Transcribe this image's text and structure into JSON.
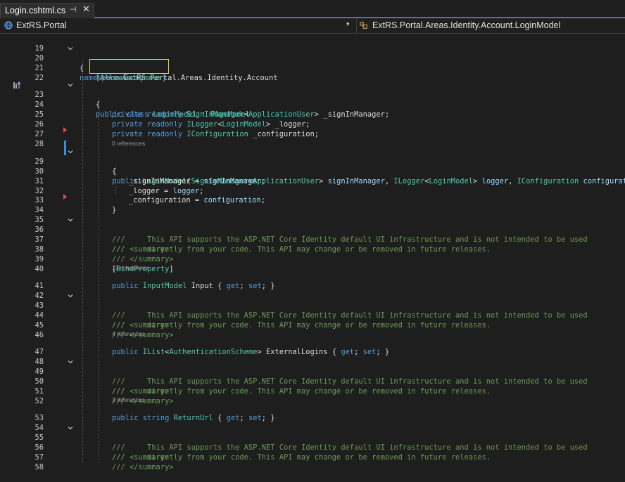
{
  "tab": {
    "title": "Login.cshtml.cs",
    "pin_glyph": "⊣",
    "close_glyph": "✕"
  },
  "nav": {
    "project": "ExtRS.Portal",
    "member": "ExtRS.Portal.Areas.Identity.Account.LoginModel",
    "caret": "▾"
  },
  "colors": {
    "accent": "#6c5fc7",
    "highlight_box": "#e2d84a",
    "breakpoint": "#d9534f",
    "change_bar": "#3b8ee8"
  },
  "lenses": {
    "l23": "7 references",
    "l29": "0 references",
    "l41": "13 references",
    "l47": "4 references",
    "l53": "3 references"
  },
  "code": {
    "l19": "",
    "l20_kw": "namespace",
    "l20_ns": " ExtRS.Portal.Areas.Identity.Account",
    "l21": "{",
    "l22_attr": "[AllowAnonymous]",
    "l23_kw": "public class ",
    "l23_name": "LoginModel",
    "l23_sep": " : ",
    "l23_base": "PageModel",
    "l24": "{",
    "l25_kw": "private readonly ",
    "l25_t1": "SignInManager",
    "l25_lt": "<",
    "l25_t2": "ApplicationUser",
    "l25_rest": "> _signInManager;",
    "l26_kw": "private readonly ",
    "l26_t1": "ILogger",
    "l26_lt": "<",
    "l26_t2": "LoginModel",
    "l26_rest": "> _logger;",
    "l27_kw": "private readonly ",
    "l27_t1": "IConfiguration",
    "l27_rest": " _configuration;",
    "l28": "",
    "l29_kw": "public ",
    "l29_name": "LoginModel",
    "l29_p1": "(",
    "l29_t1": "SignInManager",
    "l29_lt": "<",
    "l29_t2": "ApplicationUser",
    "l29_g": "> ",
    "l29_a1": "signInManager",
    "l29_c1": ", ",
    "l29_t3": "ILogger",
    "l29_lt2": "<",
    "l29_t4": "LoginModel",
    "l29_g2": "> ",
    "l29_a2": "logger",
    "l29_c2": ", ",
    "l29_t5": "IConfiguration",
    "l29_sp": " ",
    "l29_a3": "configuration",
    "l29_end": ")",
    "l30": "{",
    "l31_a": "_signInManager = ",
    "l31_b": "signInManager",
    "l31_c": ";",
    "l32_a": "_logger = ",
    "l32_b": "logger",
    "l32_c": ";",
    "l33_a": "_configuration = ",
    "l33_b": "configuration",
    "l33_c": ";",
    "l34": "}",
    "l35": "",
    "sum_open": "/// <summary>",
    "sum_l1": "///     This API supports the ASP.NET Core Identity default UI infrastructure and is not intended to be used",
    "sum_l2": "///     directly from your code. This API may change or be removed in future releases.",
    "sum_close": "/// </summary>",
    "l40_p": "[",
    "l40_attr": "BindProperty",
    "l40_e": "]",
    "l41_kw": "public ",
    "l41_t": "InputModel",
    "l41_n": " Input { ",
    "l41_get": "get",
    "l41_s1": "; ",
    "l41_set": "set",
    "l41_e": "; }",
    "l47_kw": "public ",
    "l47_t": "IList",
    "l47_lt": "<",
    "l47_t2": "AuthenticationScheme",
    "l47_n": "> ExternalLogins { ",
    "l47_get": "get",
    "l47_s1": "; ",
    "l47_set": "set",
    "l47_e": "; }",
    "l53_kw": "public string ",
    "l53_n": "ReturnUrl",
    "l53_m": " { ",
    "l53_get": "get",
    "l53_s1": "; ",
    "l53_set": "set",
    "l53_e": "; }"
  }
}
